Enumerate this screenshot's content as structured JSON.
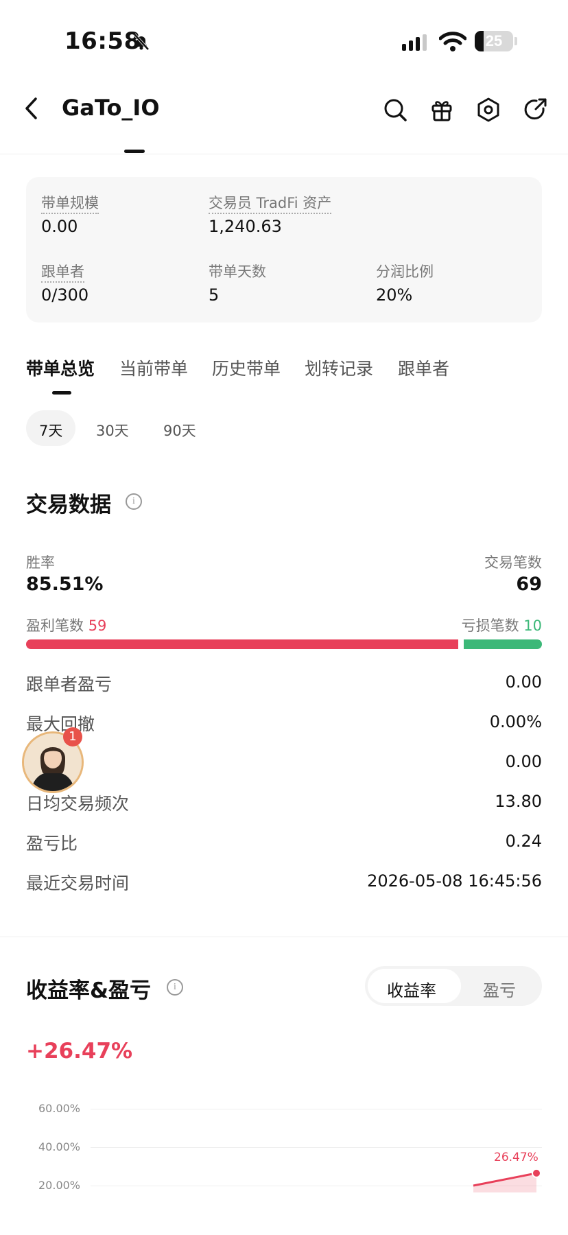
{
  "status_bar": {
    "time": "16:58",
    "battery": "25"
  },
  "header": {
    "title": "GaTo_IO"
  },
  "stats": {
    "size_label": "带单规模",
    "size_value": "0.00",
    "assets_label": "交易员 TradFi 资产",
    "assets_value": "1,240.63",
    "followers_label": "跟单者",
    "followers_value": "0/300",
    "days_label": "带单天数",
    "days_value": "5",
    "share_label": "分润比例",
    "share_value": "20%"
  },
  "tabs": [
    "带单总览",
    "当前带单",
    "历史带单",
    "划转记录",
    "跟单者"
  ],
  "periods": [
    "7天",
    "30天",
    "90天"
  ],
  "trade_data": {
    "title": "交易数据",
    "win_rate_label": "胜率",
    "win_rate": "85.51%",
    "trades_label": "交易笔数",
    "trades": "69",
    "profit_trades_label": "盈利笔数",
    "profit_trades": "59",
    "loss_trades_label": "亏损笔数",
    "loss_trades": "10",
    "rows": [
      {
        "label": "跟单者盈亏",
        "value": "0.00"
      },
      {
        "label": "最大回撤",
        "value": "0.00%"
      },
      {
        "label": "",
        "value": "0.00"
      },
      {
        "label": "日均交易频次",
        "value": "13.80"
      },
      {
        "label": "盈亏比",
        "value": "0.24"
      },
      {
        "label": "最近交易时间",
        "value": "2026-05-08 16:45:56"
      }
    ]
  },
  "avatar": {
    "badge": "1"
  },
  "returns": {
    "title": "收益率&盈亏",
    "toggle": [
      "收益率",
      "盈亏"
    ],
    "value": "+26.47%"
  },
  "chart_data": {
    "type": "line",
    "y_ticks": [
      "60.00%",
      "40.00%",
      "20.00%"
    ],
    "end_label": "26.47%",
    "values": [
      20.0,
      26.47
    ],
    "colors": {
      "line": "#e8405a"
    }
  }
}
